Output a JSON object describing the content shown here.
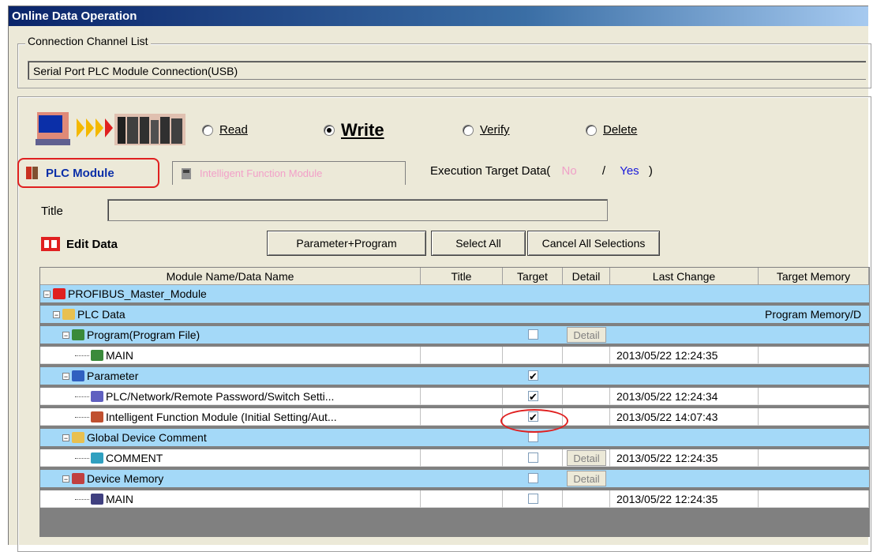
{
  "window": {
    "title": "Online Data Operation"
  },
  "connection": {
    "group_label": "Connection Channel List",
    "channel": "Serial Port  PLC Module Connection(USB)"
  },
  "operation": {
    "read_label": "Read",
    "write_label": "Write",
    "verify_label": "Verify",
    "delete_label": "Delete",
    "selected": "Write"
  },
  "tabs": {
    "plc_module": "PLC Module",
    "intelligent_function_module": "Intelligent Function Module"
  },
  "execution_target": {
    "label": "Execution Target Data(",
    "no": "No",
    "separator": "/",
    "yes": "Yes",
    "close": ")"
  },
  "title_field": {
    "label": "Title",
    "value": ""
  },
  "edit_data": {
    "label": "Edit Data"
  },
  "buttons": {
    "parameter_program": "Parameter+Program",
    "select_all": "Select All",
    "cancel_all": "Cancel All Selections"
  },
  "grid": {
    "columns": [
      "Module Name/Data Name",
      "Title",
      "Target",
      "Detail",
      "Last Change",
      "Target Memory"
    ],
    "rows": [
      {
        "name": "PROFIBUS_Master_Module",
        "icon": "module-icon",
        "level": 0,
        "style": "blue",
        "target": null,
        "detail": false,
        "last_change": "",
        "memory": ""
      },
      {
        "name": "PLC Data",
        "icon": "folder-icon",
        "level": 1,
        "style": "blue",
        "target": null,
        "detail": false,
        "last_change": "",
        "memory": "Program Memory/D"
      },
      {
        "name": "Program(Program File)",
        "icon": "program-icon",
        "level": 2,
        "style": "blue",
        "target": false,
        "detail": true,
        "last_change": "",
        "memory": ""
      },
      {
        "name": "MAIN",
        "icon": "program-file-icon",
        "level": 3,
        "style": "white",
        "target": null,
        "detail": false,
        "last_change": "2013/05/22 12:24:35",
        "memory": ""
      },
      {
        "name": "Parameter",
        "icon": "parameter-icon",
        "level": 2,
        "style": "blue",
        "target": true,
        "detail": false,
        "last_change": "",
        "memory": ""
      },
      {
        "name": "PLC/Network/Remote Password/Switch Setti...",
        "icon": "param-file-icon",
        "level": 3,
        "style": "white",
        "target": true,
        "detail": false,
        "last_change": "2013/05/22 12:24:34",
        "memory": ""
      },
      {
        "name": "Intelligent Function Module (Initial Setting/Aut...",
        "icon": "ifm-file-icon",
        "level": 3,
        "style": "white",
        "target": true,
        "detail": false,
        "last_change": "2013/05/22 14:07:43",
        "memory": ""
      },
      {
        "name": "Global Device Comment",
        "icon": "folder-icon",
        "level": 2,
        "style": "blue",
        "target": false,
        "detail": false,
        "last_change": "",
        "memory": ""
      },
      {
        "name": "COMMENT",
        "icon": "comment-icon",
        "level": 3,
        "style": "white",
        "target": false,
        "detail": true,
        "last_change": "2013/05/22 12:24:35",
        "memory": ""
      },
      {
        "name": "Device Memory",
        "icon": "device-memory-icon",
        "level": 2,
        "style": "blue",
        "target": false,
        "detail": true,
        "last_change": "",
        "memory": ""
      },
      {
        "name": "MAIN",
        "icon": "memory-file-icon",
        "level": 3,
        "style": "white",
        "target": false,
        "detail": false,
        "last_change": "2013/05/22 12:24:35",
        "memory": ""
      }
    ],
    "detail_label": "Detail"
  },
  "colors": {
    "highlight": "#e02020",
    "row_blue": "#a4d9f8",
    "tab_text": "#0b2fa8"
  }
}
